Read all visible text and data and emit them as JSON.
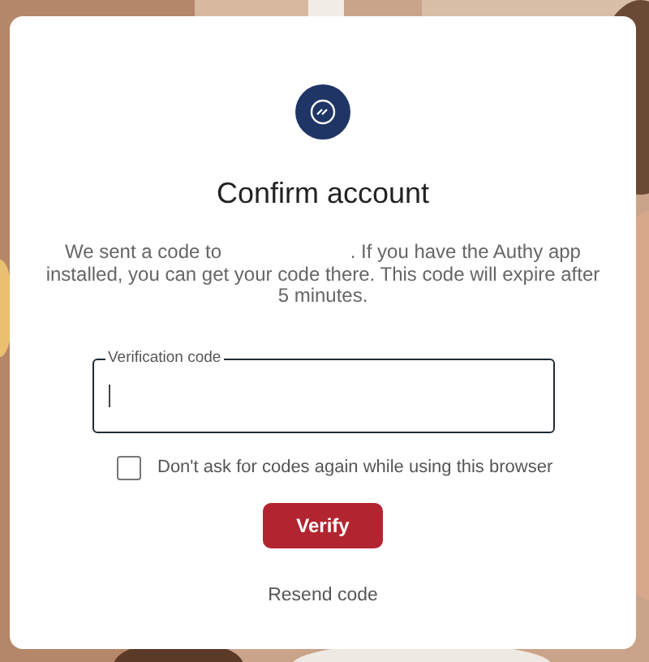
{
  "dialog": {
    "title": "Confirm account",
    "message": {
      "before": "We sent a code to",
      "after": ". If you have the Authy app installed, you can get your code there. This code will expire after 5 minutes."
    },
    "code_field": {
      "label": "Verification code",
      "focused": true
    },
    "remember_checkbox": {
      "label": "Don't ask for codes again while using this browser",
      "checked": false
    },
    "verify_button": "Verify",
    "resend_link": "Resend code"
  }
}
